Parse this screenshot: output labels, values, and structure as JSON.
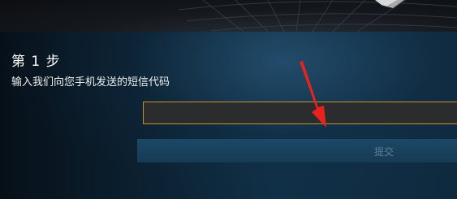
{
  "step": {
    "title": "第 1 步",
    "description": "输入我们向您手机发送的短信代码"
  },
  "form": {
    "code_value": "",
    "submit_label": "提交"
  },
  "colors": {
    "input_border": "#c8922a",
    "arrow": "#e8231d",
    "button_bg": "#1c4866",
    "button_text": "#5d7f98"
  },
  "icons": [
    "red-pointer-arrow-icon"
  ]
}
